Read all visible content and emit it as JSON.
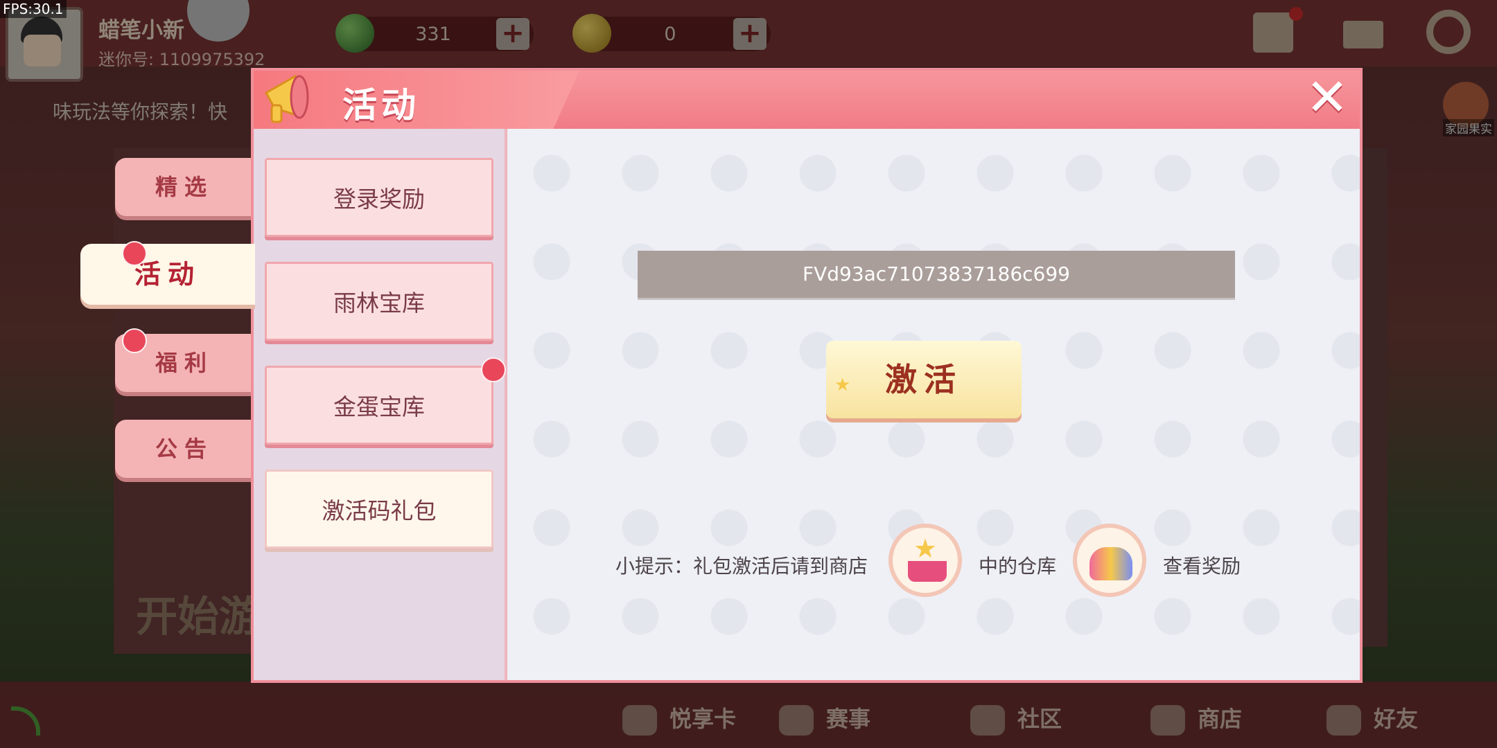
{
  "hud": {
    "fps": "FPS:30.1",
    "player_name": "蜡笔小新",
    "player_id": "迷你号: 1109975392",
    "green_currency": "331",
    "gold_currency": "0",
    "ticker": "味玩法等你探索！快",
    "promo_label": "家园果实",
    "start_text": "开始游"
  },
  "categories": [
    "精选",
    "活动",
    "福利",
    "公告"
  ],
  "modal": {
    "title": "活动",
    "close": "✕",
    "sub_tabs": [
      "登录奖励",
      "雨林宝库",
      "金蛋宝库",
      "激活码礼包"
    ],
    "code_value": "FVd93ac71073837186c699",
    "activate_label": "激活",
    "tip_prefix": "小提示：礼包激活后请到商店",
    "tip_middle": "中的仓库",
    "tip_suffix": "查看奖励"
  },
  "bottom_nav": [
    "悦享卡",
    "赛事",
    "社区",
    "商店",
    "好友"
  ],
  "colors": {
    "accent": "#f07c86",
    "title_text": "#ffffff",
    "activate_text": "#9c3020"
  }
}
